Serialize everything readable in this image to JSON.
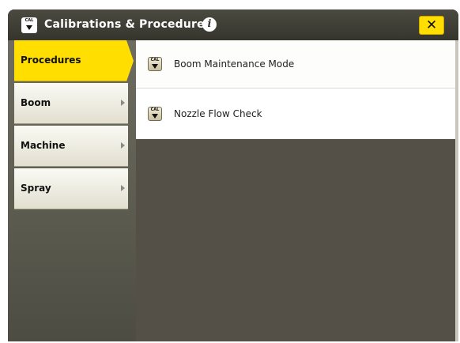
{
  "window": {
    "title": "Calibrations & Procedures",
    "title_icon": "cal-icon",
    "info_icon": "info-icon",
    "close_label": "✕"
  },
  "sidebar": {
    "items": [
      {
        "label": "Procedures",
        "active": true
      },
      {
        "label": "Boom",
        "active": false
      },
      {
        "label": "Machine",
        "active": false
      },
      {
        "label": "Spray",
        "active": false
      }
    ]
  },
  "procedures": {
    "items": [
      {
        "label": "Boom Maintenance Mode",
        "icon": "cal-icon"
      },
      {
        "label": "Nozzle Flow Check",
        "icon": "cal-icon"
      }
    ]
  },
  "icon_text": "CAL",
  "colors": {
    "accent": "#ffde00",
    "titlebar": "#3e3d34",
    "content_bg": "#544f47"
  }
}
